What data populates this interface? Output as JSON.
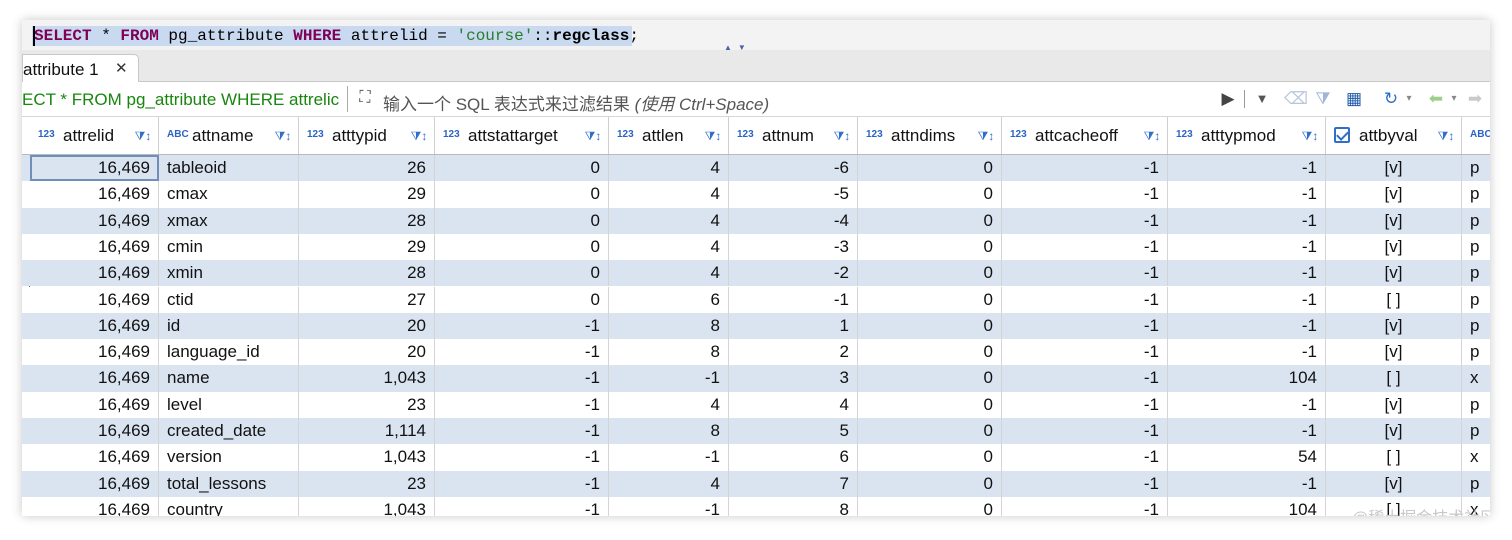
{
  "sql": {
    "parts": [
      {
        "t": "SELECT",
        "c": "kw"
      },
      {
        "t": " * ",
        "c": ""
      },
      {
        "t": "FROM",
        "c": "kw"
      },
      {
        "t": " pg_attribute ",
        "c": ""
      },
      {
        "t": "WHERE",
        "c": "kw"
      },
      {
        "t": " attrelid = ",
        "c": ""
      },
      {
        "t": "'course'",
        "c": "str"
      },
      {
        "t": "::",
        "c": ""
      },
      {
        "t": "regclass",
        "c": "fn"
      },
      {
        "t": ";",
        "c": ""
      }
    ]
  },
  "tab": {
    "label": "attribute 1",
    "close_icon": "✕"
  },
  "filter": {
    "prefix": "ECT * FROM pg_attribute WHERE attrelic",
    "placeholder_main": "输入一个 SQL 表达式来过滤结果 ",
    "placeholder_hint": "(使用 Ctrl+Space)"
  },
  "columns": [
    {
      "name": "attrelid",
      "type": "123",
      "align": "num"
    },
    {
      "name": "attname",
      "type": "ABC",
      "align": "txt"
    },
    {
      "name": "atttypid",
      "type": "123",
      "align": "num"
    },
    {
      "name": "attstattarget",
      "type": "123",
      "align": "num"
    },
    {
      "name": "attlen",
      "type": "123",
      "align": "num"
    },
    {
      "name": "attnum",
      "type": "123",
      "align": "num"
    },
    {
      "name": "attndims",
      "type": "123",
      "align": "num"
    },
    {
      "name": "attcacheoff",
      "type": "123",
      "align": "num"
    },
    {
      "name": "atttypmod",
      "type": "123",
      "align": "num"
    },
    {
      "name": "attbyval",
      "type": "check",
      "align": "ctr"
    },
    {
      "name": "",
      "type": "ABC",
      "align": "txt"
    }
  ],
  "rows": [
    [
      "16,469",
      "tableoid",
      "26",
      "0",
      "4",
      "-6",
      "0",
      "-1",
      "-1",
      "[v]",
      "p"
    ],
    [
      "16,469",
      "cmax",
      "29",
      "0",
      "4",
      "-5",
      "0",
      "-1",
      "-1",
      "[v]",
      "p"
    ],
    [
      "16,469",
      "xmax",
      "28",
      "0",
      "4",
      "-4",
      "0",
      "-1",
      "-1",
      "[v]",
      "p"
    ],
    [
      "16,469",
      "cmin",
      "29",
      "0",
      "4",
      "-3",
      "0",
      "-1",
      "-1",
      "[v]",
      "p"
    ],
    [
      "16,469",
      "xmin",
      "28",
      "0",
      "4",
      "-2",
      "0",
      "-1",
      "-1",
      "[v]",
      "p"
    ],
    [
      "16,469",
      "ctid",
      "27",
      "0",
      "6",
      "-1",
      "0",
      "-1",
      "-1",
      "[ ]",
      "p"
    ],
    [
      "16,469",
      "id",
      "20",
      "-1",
      "8",
      "1",
      "0",
      "-1",
      "-1",
      "[v]",
      "p"
    ],
    [
      "16,469",
      "language_id",
      "20",
      "-1",
      "8",
      "2",
      "0",
      "-1",
      "-1",
      "[v]",
      "p"
    ],
    [
      "16,469",
      "name",
      "1,043",
      "-1",
      "-1",
      "3",
      "0",
      "-1",
      "104",
      "[ ]",
      "x"
    ],
    [
      "16,469",
      "level",
      "23",
      "-1",
      "4",
      "4",
      "0",
      "-1",
      "-1",
      "[v]",
      "p"
    ],
    [
      "16,469",
      "created_date",
      "1,114",
      "-1",
      "8",
      "5",
      "0",
      "-1",
      "-1",
      "[v]",
      "p"
    ],
    [
      "16,469",
      "version",
      "1,043",
      "-1",
      "-1",
      "6",
      "0",
      "-1",
      "54",
      "[ ]",
      "x"
    ],
    [
      "16,469",
      "total_lessons",
      "23",
      "-1",
      "4",
      "7",
      "0",
      "-1",
      "-1",
      "[v]",
      "p"
    ],
    [
      "16,469",
      "country",
      "1,043",
      "-1",
      "-1",
      "8",
      "0",
      "-1",
      "104",
      "[ ]",
      "x"
    ]
  ],
  "watermark": "@稀土掘金技术社区",
  "colors": {
    "row_stripe": "#dae4f1",
    "keyword": "#7f0055",
    "string": "#2a7d2a",
    "filter_text": "#19860f",
    "icon_blue": "#2f6fc9"
  }
}
